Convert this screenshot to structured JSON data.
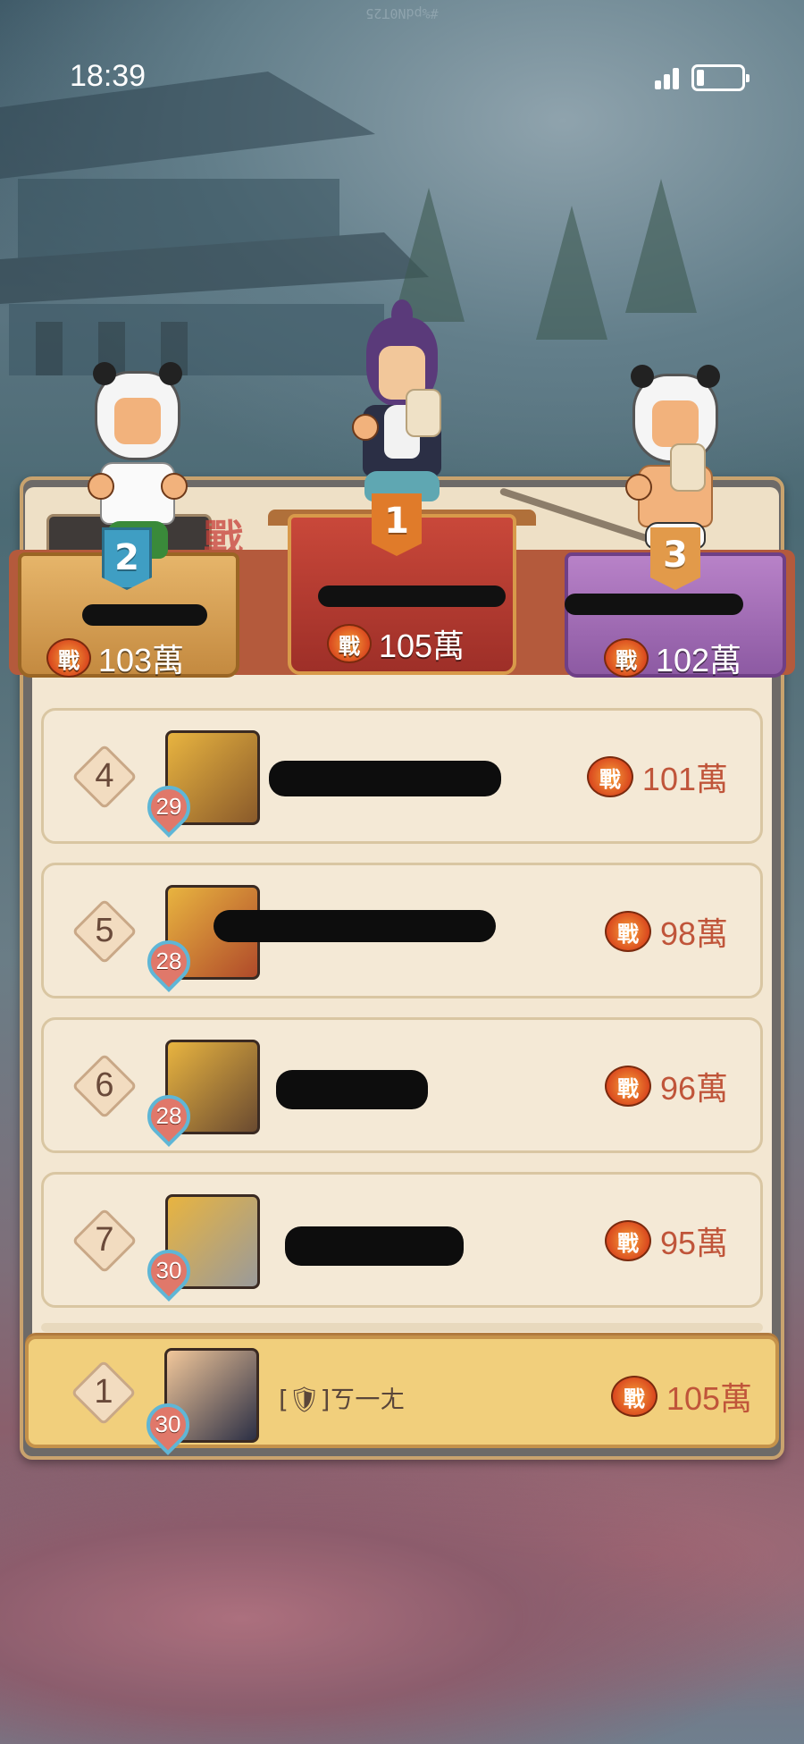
{
  "watermark": "#%pdN0T25",
  "status_bar": {
    "time": "18:39"
  },
  "podium": [
    {
      "rank": "2",
      "power": "103萬"
    },
    {
      "rank": "1",
      "power": "105萬"
    },
    {
      "rank": "3",
      "power": "102萬"
    }
  ],
  "badge_label": "戰",
  "list": [
    {
      "rank": "4",
      "level": "29",
      "power": "101萬"
    },
    {
      "rank": "5",
      "level": "28",
      "power": "98萬"
    },
    {
      "rank": "6",
      "level": "28",
      "power": "96萬"
    },
    {
      "rank": "7",
      "level": "30",
      "power": "95萬"
    }
  ],
  "self": {
    "rank": "1",
    "level": "30",
    "name": "[🛡]ㄎ一ㄤ",
    "power": "105萬"
  },
  "colors": {
    "accent_power": "#c0553a",
    "gold": "#f1cf7c",
    "panel": "#f4e9d6"
  }
}
